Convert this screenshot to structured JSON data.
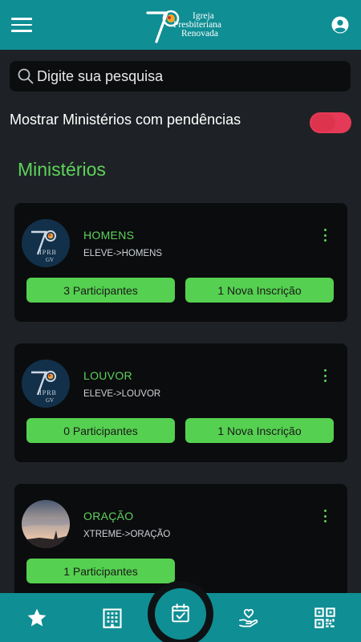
{
  "header": {
    "logo_number": "70",
    "logo_line1": "Igreja",
    "logo_line2": "Presbiteriana",
    "logo_line3": "Renovada",
    "menu_icon": "hamburger-icon",
    "profile_icon": "account-circle-icon"
  },
  "search": {
    "placeholder": "Digite sua pesquisa",
    "value": ""
  },
  "filter": {
    "label": "Mostrar Ministérios com pendências",
    "enabled": true,
    "accent": "#f03c5a"
  },
  "section": {
    "title": "Ministérios"
  },
  "ministries": [
    {
      "name": "HOMENS",
      "path": "ELEVE->HOMENS",
      "participants_label": "3 Participantes",
      "inscriptions_label": "1 Nova Inscrição",
      "avatar_caption": "IPRB\nGV"
    },
    {
      "name": "LOUVOR",
      "path": "ELEVE->LOUVOR",
      "participants_label": "0 Participantes",
      "inscriptions_label": "1 Nova Inscrição",
      "avatar_caption": "IPRB\nGV"
    },
    {
      "name": "ORAÇÃO",
      "path": "XTREME->ORAÇÃO",
      "participants_label": "1 Participantes"
    }
  ],
  "bottom_nav": {
    "items": [
      "star-icon",
      "building-icon",
      "calendar-check-icon",
      "hands-heart-icon",
      "qr-code-icon"
    ],
    "active": "calendar-check-icon"
  },
  "colors": {
    "primary": "#0f8e94",
    "accent_green": "#5ed35b",
    "button_green": "#55d050",
    "background": "#1e2226",
    "card": "#0b0c0e"
  }
}
